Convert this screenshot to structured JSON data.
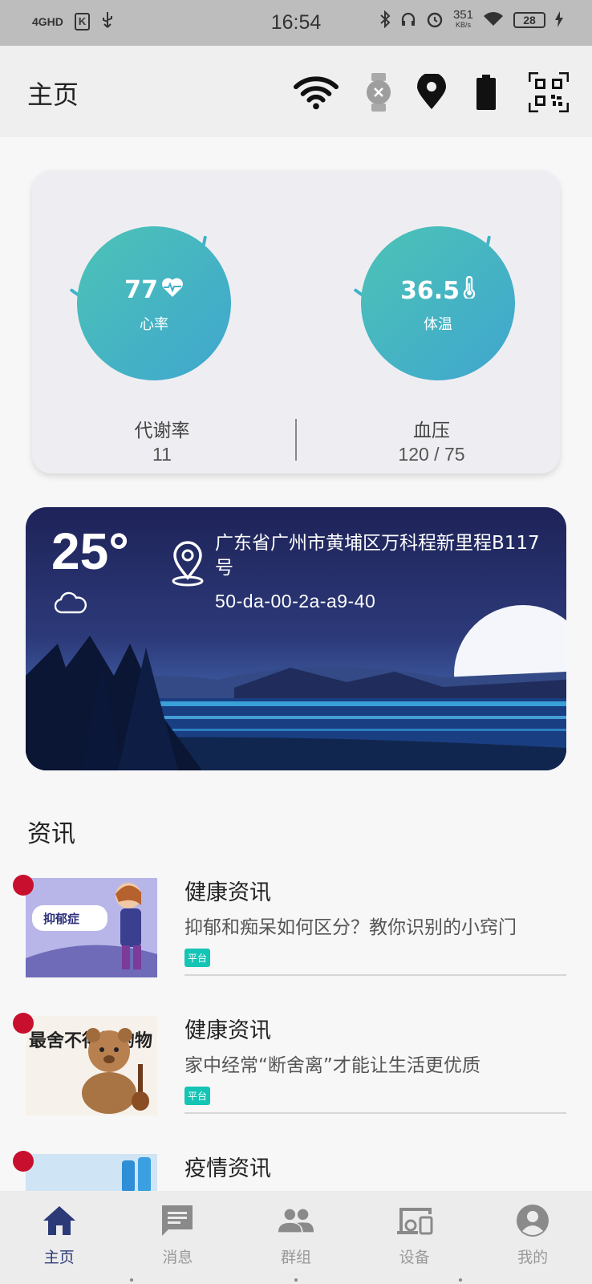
{
  "status_bar": {
    "network": "4GHD",
    "app_badge": "K",
    "time": "16:54",
    "net_speed": "351",
    "net_speed_unit": "KB/s",
    "battery": "28"
  },
  "app_bar": {
    "title": "主页",
    "icons": [
      "wifi-icon",
      "watch-disconnected-icon",
      "location-icon",
      "battery-icon",
      "qr-code-icon"
    ]
  },
  "health": {
    "heart_rate": {
      "value": "77",
      "label": "心率",
      "icon": "heart-pulse-icon",
      "level": 0.33
    },
    "body_temp": {
      "value": "36.5",
      "label": "体温",
      "icon": "thermometer-icon",
      "level": 0.33
    },
    "metabolic": {
      "label": "代谢率",
      "value": "11"
    },
    "blood_pressure": {
      "label": "血压",
      "value": "120 / 75"
    },
    "gauge_color": "#3fb4c8"
  },
  "weather": {
    "temperature": "25°",
    "condition_icon": "cloud-icon",
    "address": "广东省广州市黄埔区万科程新里程B117号",
    "device_mac": "50-da-00-2a-a9-40"
  },
  "news": {
    "section_title": "资讯",
    "items": [
      {
        "category": "健康资讯",
        "title": "抑郁和痴呆如何区分？教你识别的小窍门",
        "tag": "平台",
        "thumb_text": "抑郁症"
      },
      {
        "category": "健康资讯",
        "title": "家中经常“断舍离”才能让生活更优质",
        "tag": "平台",
        "thumb_text": "最舍不得扔的物"
      },
      {
        "category": "疫情资讯",
        "title": "",
        "tag": "",
        "thumb_text": ""
      }
    ],
    "accent": "#14c4b4",
    "unread_color": "#c8102e"
  },
  "bottom_nav": {
    "items": [
      {
        "label": "主页",
        "icon": "home-icon",
        "active": true
      },
      {
        "label": "消息",
        "icon": "message-icon",
        "active": false
      },
      {
        "label": "群组",
        "icon": "group-icon",
        "active": false
      },
      {
        "label": "设备",
        "icon": "devices-icon",
        "active": false
      },
      {
        "label": "我的",
        "icon": "account-icon",
        "active": false
      }
    ],
    "active_color": "#2c3a78"
  }
}
